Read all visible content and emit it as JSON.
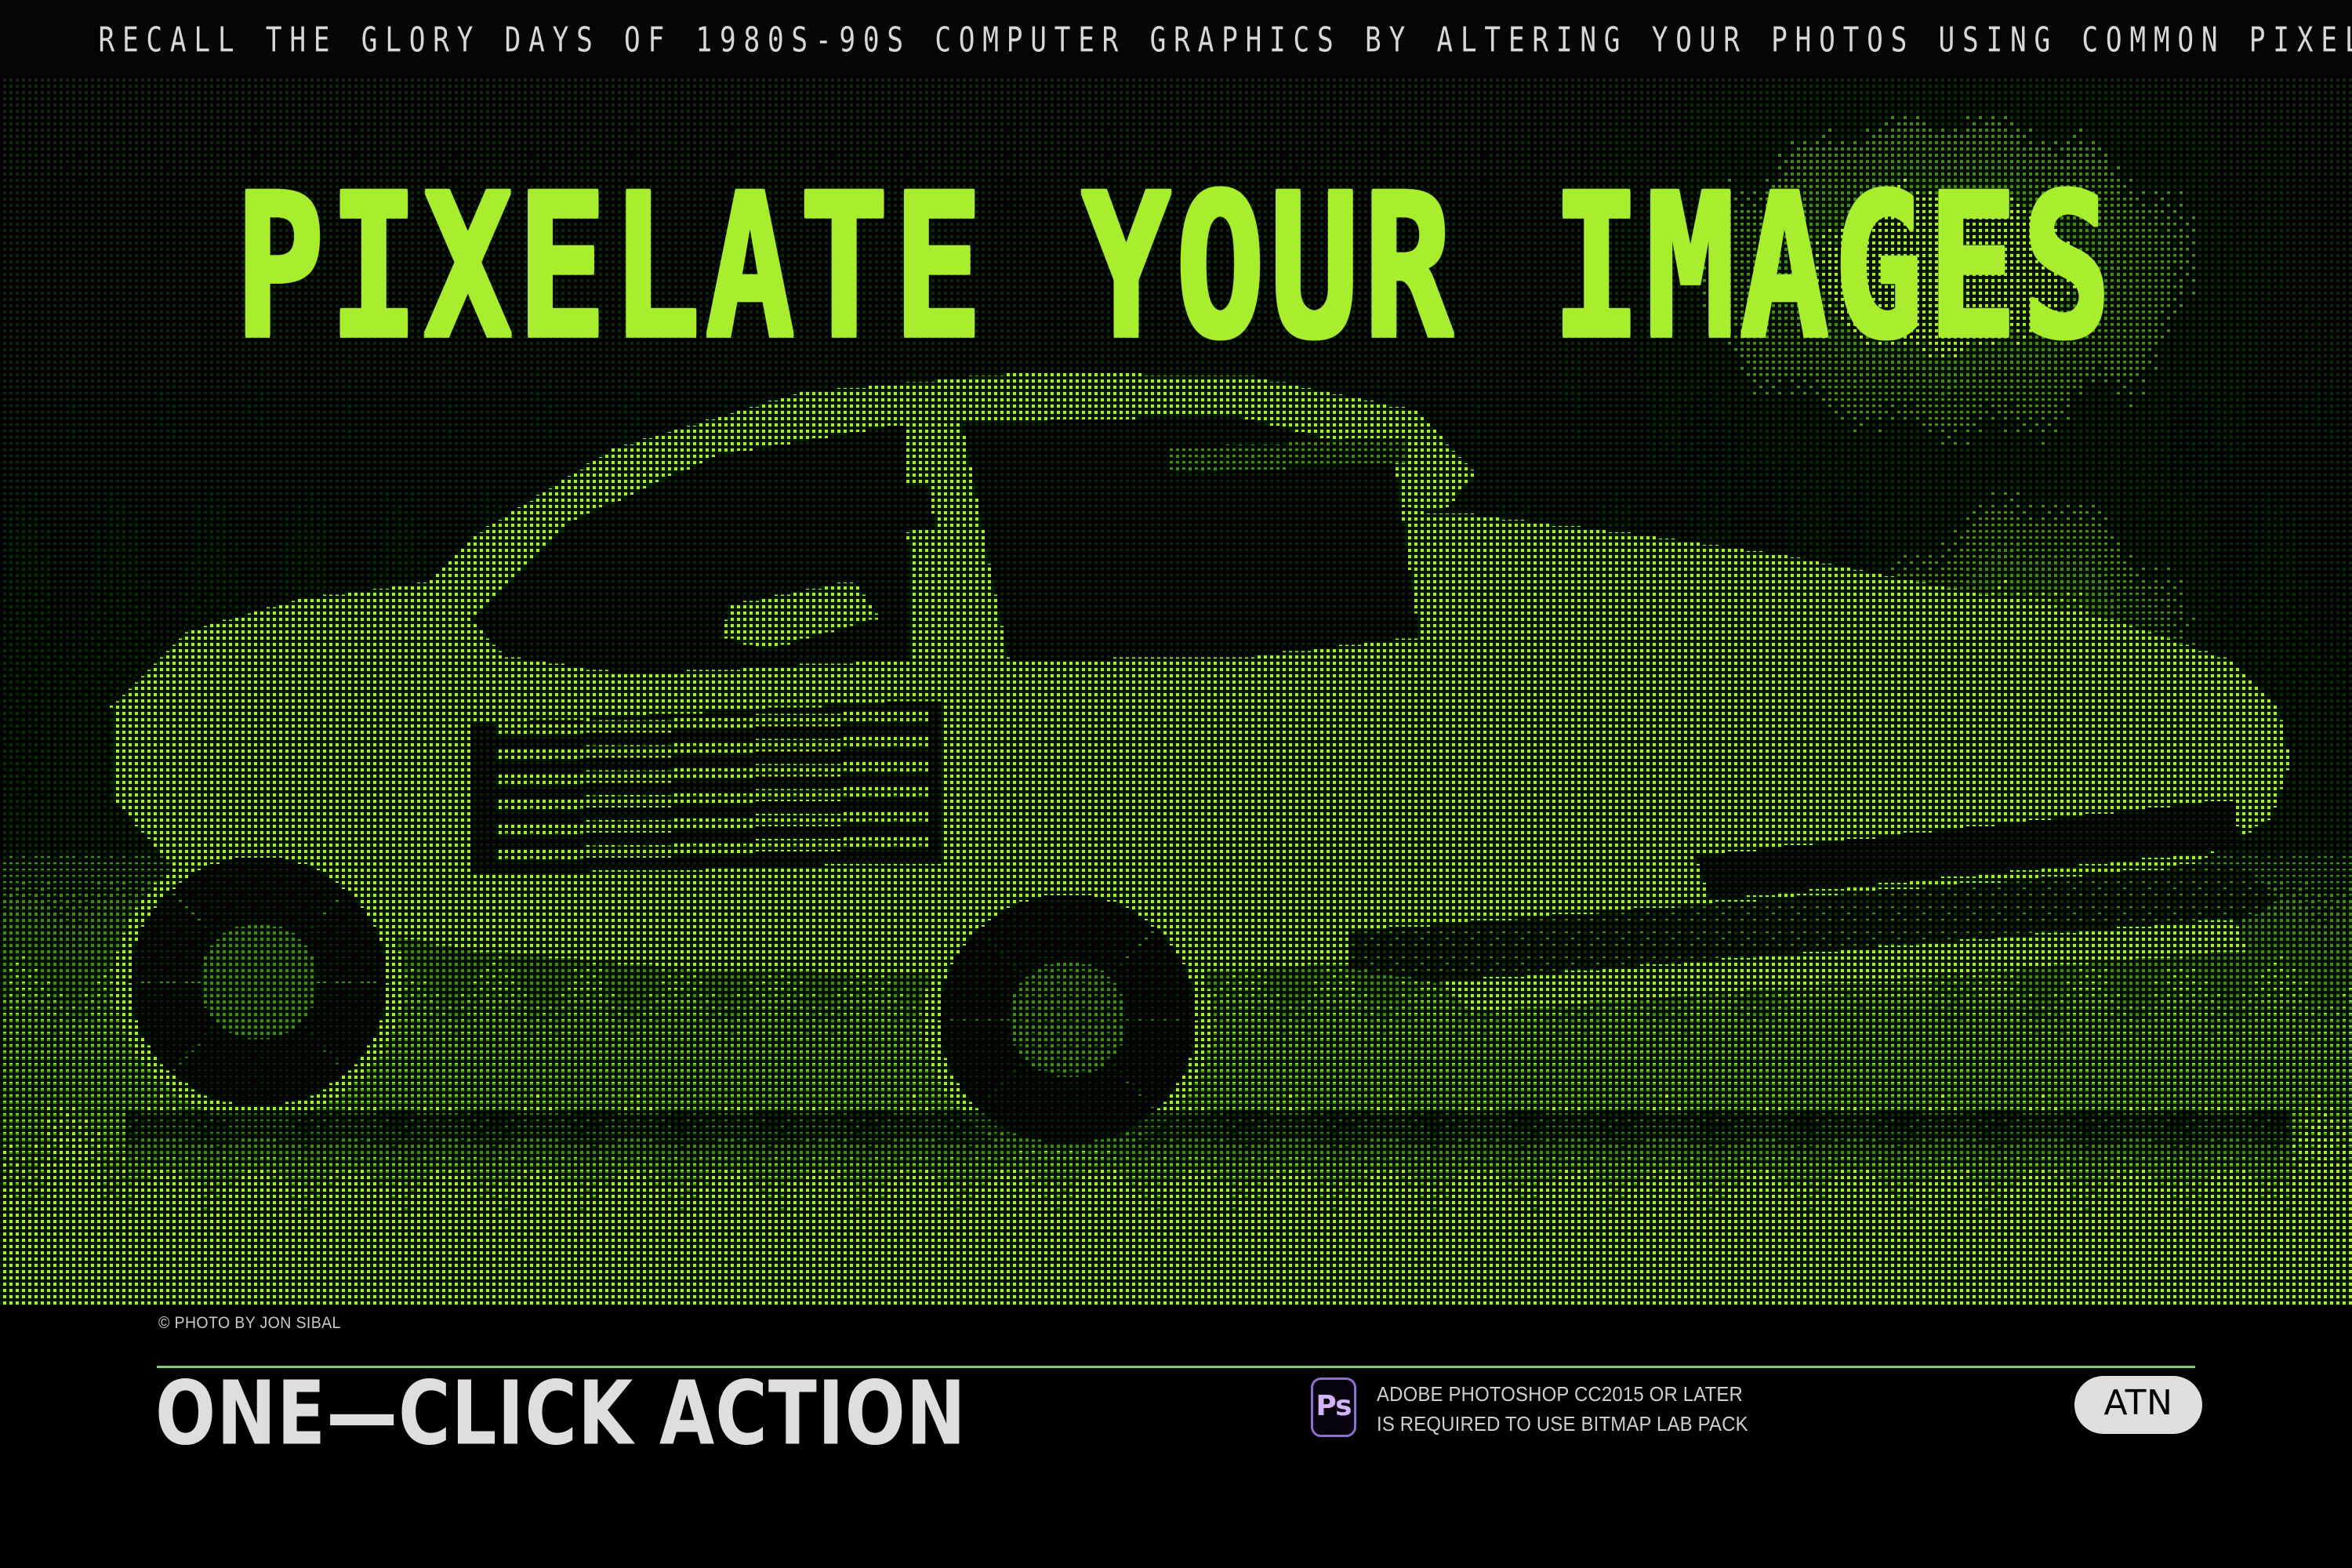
{
  "ticker": {
    "text": "RECALL THE GLORY DAYS OF 1980S-90S COMPUTER GRAPHICS BY ALTERING YOUR PHOTOS USING COMMON PIXEL PATTERNS OF THAT ERA"
  },
  "hero": {
    "headline": "PIXELATE YOUR IMAGES",
    "subject": "ferrari-testarossa-dithered-duotone-photo",
    "colors": {
      "bright_green": "#A8EE2E",
      "mid_green": "#3E8E12",
      "dark_green": "#0A2C05",
      "black": "#000000"
    }
  },
  "footer": {
    "credit": "© PHOTO BY JON SIBAL",
    "title": "ONE—CLICK ACTION",
    "photoshop": {
      "icon_label": "Ps",
      "line1": "ADOBE PHOTOSHOP CC2015 OR LATER",
      "line2": "IS REQUIRED TO USE BITMAP LAB PACK",
      "icon_color": "#8D6FD0",
      "icon_text_color": "#D3B4F6"
    },
    "badge": {
      "label": "ATN",
      "bg": "#DEDEDE",
      "fg": "#000000"
    },
    "divider_color": "#86C96F"
  }
}
